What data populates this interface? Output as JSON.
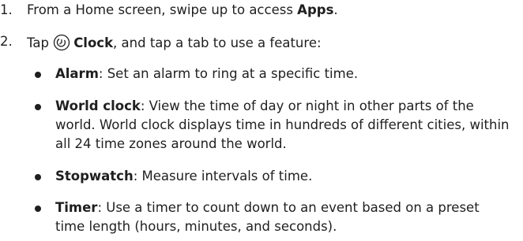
{
  "steps": [
    {
      "number": "1.",
      "pre": "From a Home screen, swipe up to access ",
      "bold": "Apps",
      "post": "."
    },
    {
      "number": "2.",
      "pre": "Tap ",
      "icon": "clock-icon",
      "bold": "Clock",
      "post": ", and tap a tab to use a feature:"
    }
  ],
  "features": [
    {
      "name": "Alarm",
      "desc": ": Set an alarm to ring at a specific time."
    },
    {
      "name": "World clock",
      "desc": ": View the time of day or night in other parts of the world. World clock displays time in hundreds of different cities, within all 24 time zones around the world."
    },
    {
      "name": "Stopwatch",
      "desc": ": Measure intervals of time."
    },
    {
      "name": "Timer",
      "desc": ": Use a timer to count down to an event based on a preset time length (hours, minutes, and seconds)."
    }
  ]
}
